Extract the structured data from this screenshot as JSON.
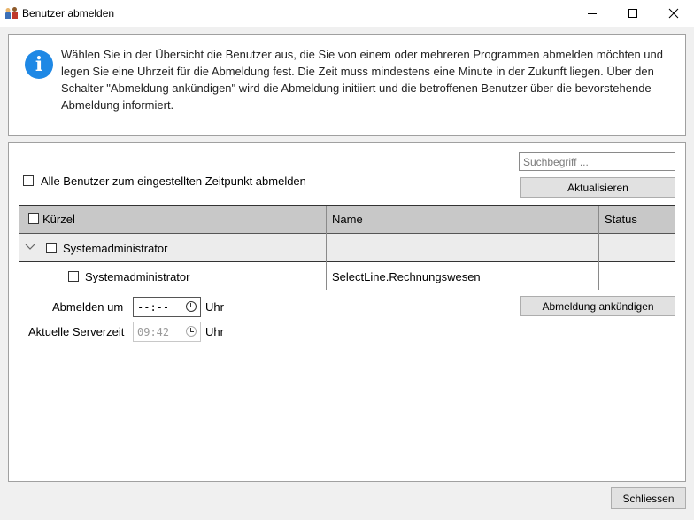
{
  "window": {
    "title": "Benutzer abmelden",
    "icons": [
      "app-icon",
      "minimize-icon",
      "maximize-icon",
      "close-icon"
    ]
  },
  "info": {
    "icon": "info-icon",
    "text": "Wählen Sie in der Übersicht die Benutzer aus, die Sie von einem oder mehreren Programmen abmelden möchten und legen Sie eine Uhrzeit für die Abmeldung fest. Die Zeit muss mindestens eine Minute in der Zukunft liegen. Über den Schalter \"Abmeldung ankündigen\" wird die Abmeldung initiiert und die betroffenen Benutzer über die bevorstehende Abmeldung informiert."
  },
  "search": {
    "placeholder": "Suchbegriff ..."
  },
  "all_users_label": "Alle Benutzer zum eingestellten Zeitpunkt abmelden",
  "refresh_button": "Aktualisieren",
  "grid": {
    "columns": [
      "Kürzel",
      "Name",
      "Status"
    ],
    "group": {
      "label": "Systemadministrator",
      "expanded": true
    },
    "rows": [
      {
        "kuerzel": "Systemadministrator",
        "name": "SelectLine.Rechnungswesen",
        "status": ""
      }
    ]
  },
  "logout_at": {
    "label": "Abmelden um",
    "value": "--:--",
    "unit": "Uhr"
  },
  "server_time": {
    "label": "Aktuelle Serverzeit",
    "value": "09:42",
    "unit": "Uhr"
  },
  "announce_button": "Abmeldung ankündigen",
  "close_button": "Schliessen"
}
